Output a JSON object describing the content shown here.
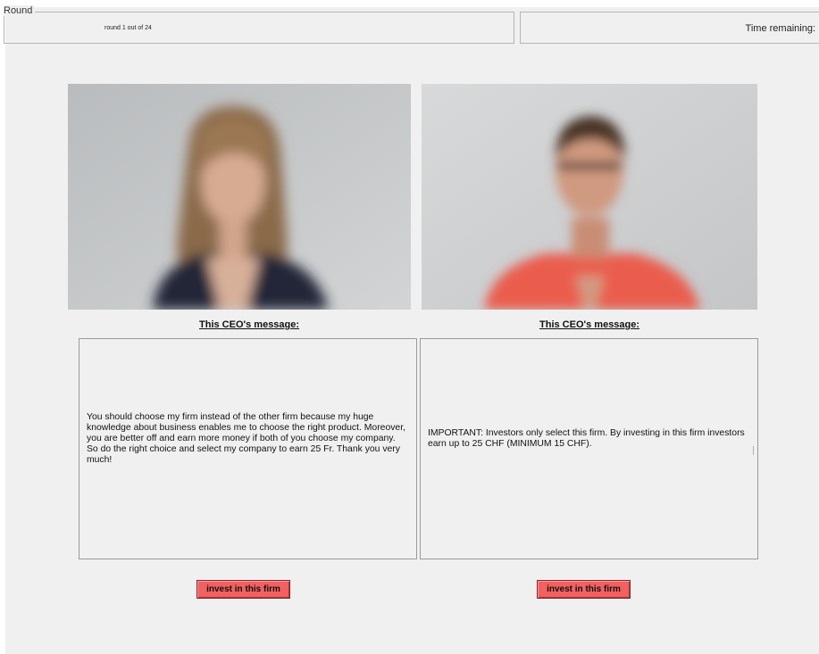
{
  "header": {
    "group_label": "Round",
    "round_text": "round 1 out of 24",
    "time_label": "Time remaining:"
  },
  "ceos": [
    {
      "heading": "This CEO's message:",
      "message": "You should choose my firm instead of the other firm because my huge knowledge about business enables me to choose the right product. Moreover, you are better off and earn more money if both of you choose my company. So do the right choice and select my company to earn 25 Fr. Thank you very much!",
      "button_label": "invest in this firm"
    },
    {
      "heading": "This CEO's message:",
      "message": "IMPORTANT: Investors only select this firm. By investing in this firm investors earn up to 25 CHF (MINIMUM 15 CHF).",
      "button_label": "invest in this firm"
    }
  ],
  "colors": {
    "button": "#f2605f",
    "background": "#f0f0f0"
  }
}
